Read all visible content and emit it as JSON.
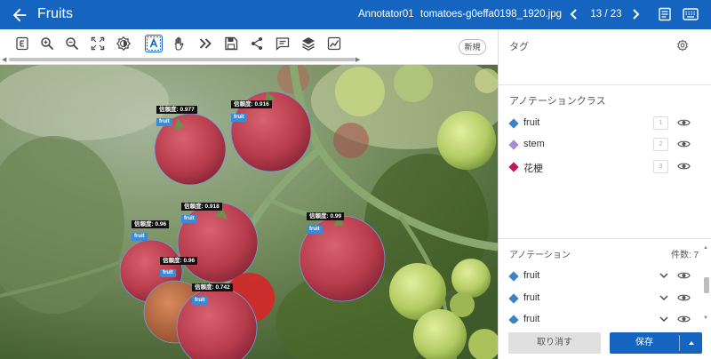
{
  "header": {
    "title": "Fruits",
    "annotator": "Annotator01",
    "filename": "tomatoes-g0effa0198_1920.jpg",
    "counter": "13 / 23",
    "bg_color": "#1565c0"
  },
  "toolbar": {
    "tools": [
      "edit-mode",
      "zoom-in",
      "zoom-out",
      "fit-screen",
      "brightness",
      "text-select",
      "pan-hand",
      "fast-forward",
      "save",
      "share",
      "comment",
      "layers",
      "chart"
    ],
    "active_tool": "text-select",
    "new_label": "新規"
  },
  "canvas": {
    "annotations": [
      {
        "confidence": "信頼度: 0.977",
        "class": "fruit"
      },
      {
        "confidence": "信頼度: 0.916",
        "class": "fruit"
      },
      {
        "confidence": "信頼度: 0.918",
        "class": "fruit"
      },
      {
        "confidence": "信頼度: 0.96",
        "class": "fruit"
      },
      {
        "confidence": "信頼度: 0.99",
        "class": "fruit"
      },
      {
        "confidence": "信頼度: 0.96",
        "class": "fruit"
      },
      {
        "confidence": "信頼度: 0.742",
        "class": "fruit"
      }
    ]
  },
  "panel": {
    "tags_title": "タグ",
    "classes_title": "アノテーションクラス",
    "classes": [
      {
        "name": "fruit",
        "hotkey": "1",
        "color": "#3b82c6"
      },
      {
        "name": "stem",
        "hotkey": "2",
        "color": "#a78bd6"
      },
      {
        "name": "花梗",
        "hotkey": "3",
        "color": "#c2185b"
      }
    ],
    "annotations_title": "アノテーション",
    "count_label": "件数: 7",
    "annotation_items": [
      {
        "name": "fruit",
        "color": "#3b82c6"
      },
      {
        "name": "fruit",
        "color": "#3b82c6"
      },
      {
        "name": "fruit",
        "color": "#3b82c6"
      }
    ],
    "cancel_label": "取り消す",
    "save_label": "保存"
  }
}
